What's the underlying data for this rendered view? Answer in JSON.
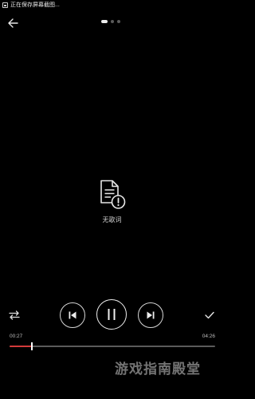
{
  "status_bar": {
    "text": "正在保存屏幕截图..."
  },
  "pager": {
    "total": 3,
    "active": 0
  },
  "lyrics": {
    "empty_text": "无歌词"
  },
  "playback": {
    "elapsed": "00:27",
    "total": "04:26",
    "progress": 0.11,
    "state": "playing"
  },
  "colors": {
    "background": "#000000",
    "progress_played": "#d33a3a",
    "progress_track": "#5b5b5b"
  },
  "icons": {
    "back": "arrow-left-icon",
    "lyrics": "document-warning-icon",
    "mode": "swap-arrows-icon",
    "prev": "skip-previous-icon",
    "play": "pause-icon",
    "next": "skip-next-icon",
    "confirm": "check-icon"
  },
  "watermark": "游戏指南殿堂"
}
